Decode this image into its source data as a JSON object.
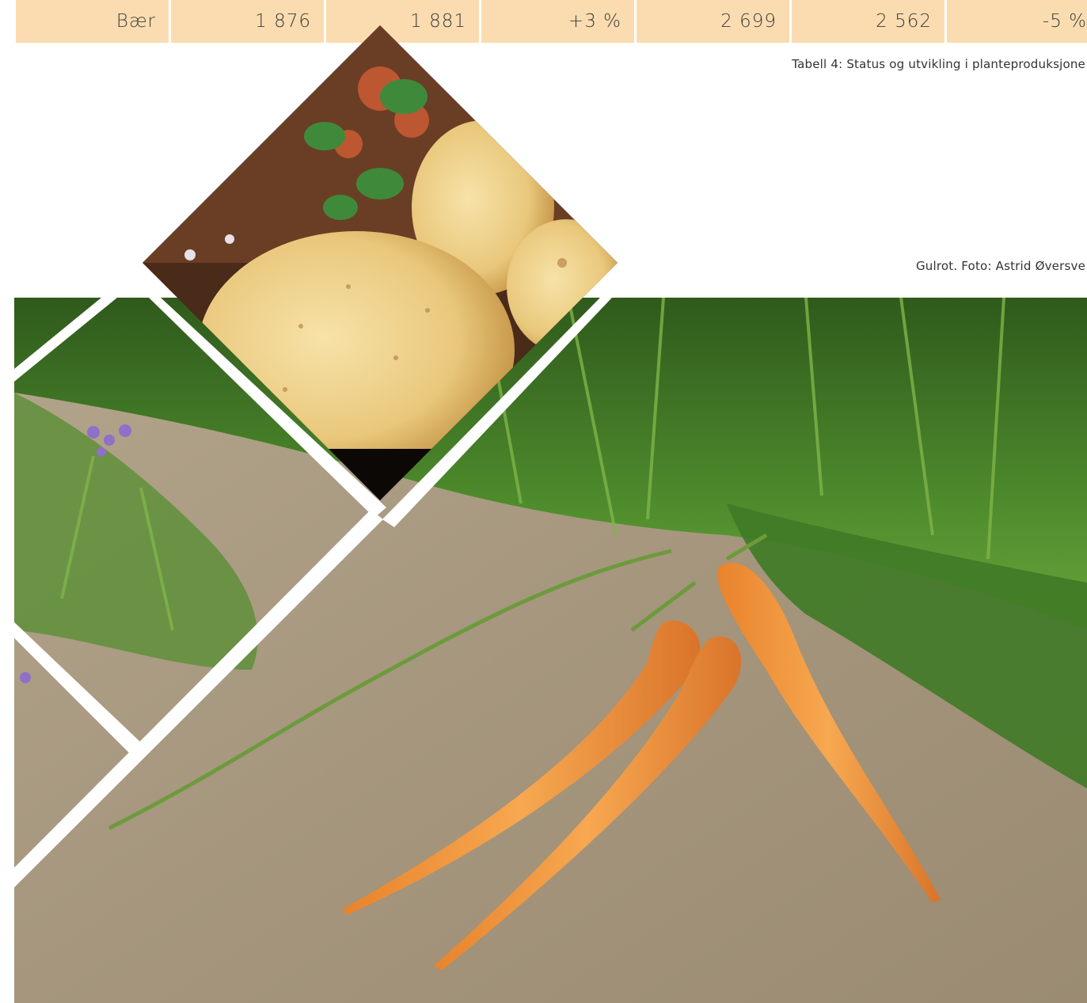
{
  "table": {
    "row": {
      "label": "Bær",
      "v1": "1 876",
      "v2": "1 881",
      "v3": "+3 %",
      "v4": "2 699",
      "v5": "2 562",
      "v6": "-5 %"
    }
  },
  "captions": {
    "table_caption": "Tabell 4: Status og utvikling i planteproduksjone",
    "photo_caption": "Gulrot. Foto:  Astrid Øversve"
  },
  "images": {
    "potato": "potato-photo",
    "carrot": "carrot-photo"
  },
  "colors": {
    "table_fill": "#fbdcb0",
    "soil": "#a89880",
    "carrot": "#f0943a",
    "leaf": "#4f8a2c"
  }
}
